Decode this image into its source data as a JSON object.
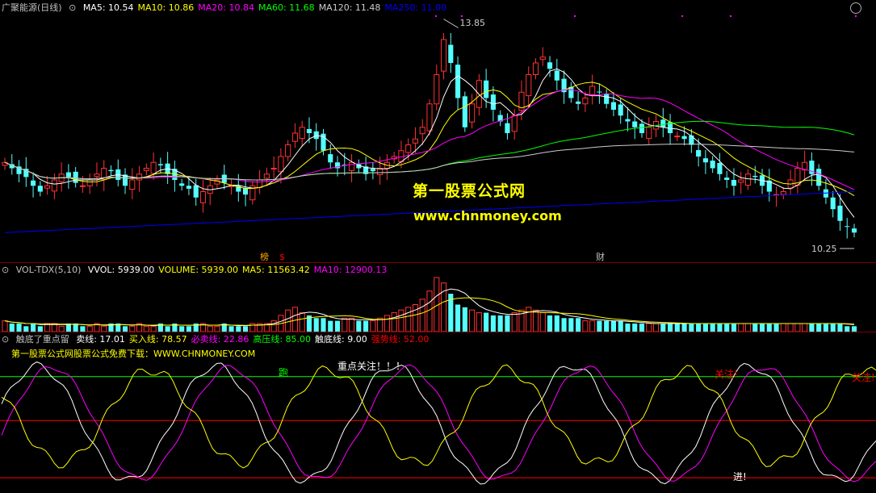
{
  "title": "广聚能源(日线)",
  "price_panel": {
    "indicators": [
      {
        "label": "MA5: 10.54",
        "color": "#ffffff"
      },
      {
        "label": "MA10: 10.86",
        "color": "#ffff00"
      },
      {
        "label": "MA20: 10.84",
        "color": "#ff00ff"
      },
      {
        "label": "MA60: 11.68",
        "color": "#00ff00"
      },
      {
        "label": "MA120: 11.48",
        "color": "#cccccc"
      },
      {
        "label": "MA250: 11.00",
        "color": "#0000ff"
      }
    ],
    "high_label": "13.85",
    "low_label": "10.25",
    "markers": [
      "榜",
      "$",
      "财"
    ]
  },
  "watermark": {
    "line1": "第一股票公式网",
    "line2": "www.chnmoney.com"
  },
  "volume_panel": {
    "title": "VOL-TDX(5,10)",
    "values": [
      {
        "label": "VVOL: 5939.00",
        "color": "#ffffff"
      },
      {
        "label": "VOLUME: 5939.00",
        "color": "#ffff00"
      },
      {
        "label": "MA5: 11563.42",
        "color": "#ffff00"
      },
      {
        "label": "MA10: 12900.13",
        "color": "#ff00ff"
      }
    ]
  },
  "osc_panel": {
    "title": "触底了重点留",
    "values": [
      {
        "label": "卖线: 17.01",
        "color": "#ffffff"
      },
      {
        "label": "买入线: 78.57",
        "color": "#ffff00"
      },
      {
        "label": "必卖线: 22.86",
        "color": "#ff00ff"
      },
      {
        "label": "高压线: 85.00",
        "color": "#00ff00"
      },
      {
        "label": "触底线: 9.00",
        "color": "#ffffff"
      },
      {
        "label": "强势线: 52.00",
        "color": "#ff0000"
      }
    ],
    "subtitle": "第一股票公式网股票公式免费下载：WWW.CHNMONEY.COM",
    "annotations": [
      "跑",
      "重点关注！！！",
      "关注!",
      "关注!",
      "进!"
    ]
  },
  "chart_data": [
    {
      "type": "candlestick",
      "title": "广聚能源(日线)",
      "ylim": [
        10.25,
        13.85
      ],
      "series": [
        {
          "name": "MA5",
          "value": 10.54,
          "color": "#ffffff"
        },
        {
          "name": "MA10",
          "value": 10.86,
          "color": "#ffff00"
        },
        {
          "name": "MA20",
          "value": 10.84,
          "color": "#ff00ff"
        },
        {
          "name": "MA60",
          "value": 11.68,
          "color": "#00ff00"
        },
        {
          "name": "MA120",
          "value": 11.48,
          "color": "#cccccc"
        },
        {
          "name": "MA250",
          "value": 11.0,
          "color": "#0000ff"
        }
      ],
      "close": [
        11.5,
        11.4,
        11.3,
        11.25,
        11.1,
        11.0,
        11.1,
        11.2,
        11.3,
        11.25,
        11.15,
        11.1,
        11.2,
        11.3,
        11.4,
        11.35,
        11.2,
        11.1,
        11.2,
        11.3,
        11.4,
        11.5,
        11.45,
        11.3,
        11.2,
        11.1,
        11.05,
        10.9,
        11.0,
        11.1,
        11.2,
        11.15,
        11.1,
        11.0,
        10.95,
        11.1,
        11.2,
        11.3,
        11.4,
        11.6,
        11.8,
        12.0,
        12.1,
        12.0,
        11.9,
        11.7,
        11.5,
        11.4,
        11.45,
        11.5,
        11.4,
        11.3,
        11.35,
        11.4,
        11.5,
        11.6,
        11.7,
        11.8,
        11.9,
        12.1,
        12.5,
        13.0,
        13.6,
        13.2,
        12.6,
        12.1,
        12.5,
        12.9,
        12.6,
        12.4,
        12.2,
        12.0,
        12.3,
        12.7,
        13.0,
        13.2,
        13.3,
        13.1,
        12.9,
        12.7,
        12.6,
        12.5,
        12.6,
        12.8,
        12.7,
        12.5,
        12.4,
        12.3,
        12.2,
        12.1,
        12.0,
        12.1,
        12.2,
        12.1,
        12.0,
        11.95,
        11.9,
        11.8,
        11.6,
        11.5,
        11.4,
        11.3,
        11.2,
        11.1,
        11.2,
        11.3,
        11.25,
        11.1,
        11.0,
        10.95,
        11.0,
        11.2,
        11.4,
        11.5,
        11.3,
        11.1,
        10.9,
        10.7,
        10.5,
        10.4,
        10.3
      ]
    },
    {
      "type": "bar",
      "title": "VOL-TDX(5,10)",
      "series": [
        {
          "name": "VVOL",
          "value": 5939.0
        },
        {
          "name": "VOLUME",
          "value": 5939.0
        },
        {
          "name": "MA5",
          "value": 11563.42
        },
        {
          "name": "MA10",
          "value": 12900.13
        }
      ],
      "values": [
        4,
        3,
        3,
        2,
        3,
        2,
        3,
        3,
        2,
        3,
        3,
        2,
        2,
        3,
        2,
        3,
        3,
        2,
        2,
        3,
        2,
        2,
        3,
        2,
        3,
        2,
        2,
        3,
        3,
        2,
        2,
        3,
        2,
        2,
        2,
        3,
        3,
        3,
        4,
        6,
        8,
        9,
        7,
        6,
        5,
        5,
        4,
        4,
        5,
        5,
        4,
        4,
        4,
        5,
        6,
        7,
        8,
        9,
        10,
        12,
        15,
        20,
        18,
        14,
        10,
        9,
        8,
        7,
        7,
        6,
        6,
        6,
        7,
        8,
        9,
        8,
        7,
        6,
        6,
        5,
        5,
        5,
        4,
        4,
        4,
        4,
        4,
        4,
        3,
        3,
        3,
        3,
        3,
        3,
        3,
        3,
        3,
        3,
        3,
        3,
        3,
        3,
        3,
        3,
        3,
        3,
        3,
        3,
        3,
        3,
        3,
        3,
        3,
        3,
        3,
        3,
        3,
        3,
        3,
        2,
        2
      ]
    },
    {
      "type": "line",
      "title": "触底了重点留",
      "ylim": [
        0,
        100
      ],
      "series": [
        {
          "name": "卖线",
          "value": 17.01,
          "color": "#ffffff"
        },
        {
          "name": "买入线",
          "value": 78.57,
          "color": "#ffff00"
        },
        {
          "name": "必卖线",
          "value": 22.86,
          "color": "#ff00ff"
        },
        {
          "name": "高压线",
          "value": 85.0,
          "color": "#00ff00"
        },
        {
          "name": "触底线",
          "value": 9.0,
          "color": "#ffffff"
        },
        {
          "name": "强势线",
          "value": 52.0,
          "color": "#ff0000"
        }
      ]
    }
  ]
}
